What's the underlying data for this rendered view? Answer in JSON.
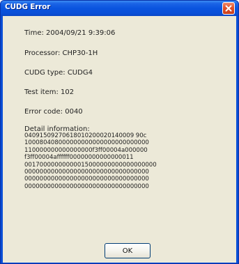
{
  "window": {
    "title": "CUDG Error"
  },
  "fields": {
    "time": "Time: 2004/09/21  9:39:06",
    "processor": "Processor: CHP30-1H",
    "cudg_type": "CUDG type: CUDG4",
    "test_item": "Test item:  102",
    "error_code": "Error code: 0040"
  },
  "detail": {
    "heading": "Detail information:",
    "lines": [
      "04091509270618010200020140009 90c",
      "100080408000000000000000000000000",
      "110000000000000000f3ff00004a000000",
      "f3ff00004affffff00000000000000011",
      "00170000000000015000000000000000000",
      "000000000000000000000000000000000",
      "000000000000000000000000000000000",
      "000000000000000000000000000000000"
    ]
  },
  "buttons": {
    "ok": "OK"
  },
  "colors": {
    "titlebar": "#0a4ed6",
    "client": "#ece9d8",
    "close": "#e0502a"
  },
  "icons": {
    "close": "close-icon"
  }
}
